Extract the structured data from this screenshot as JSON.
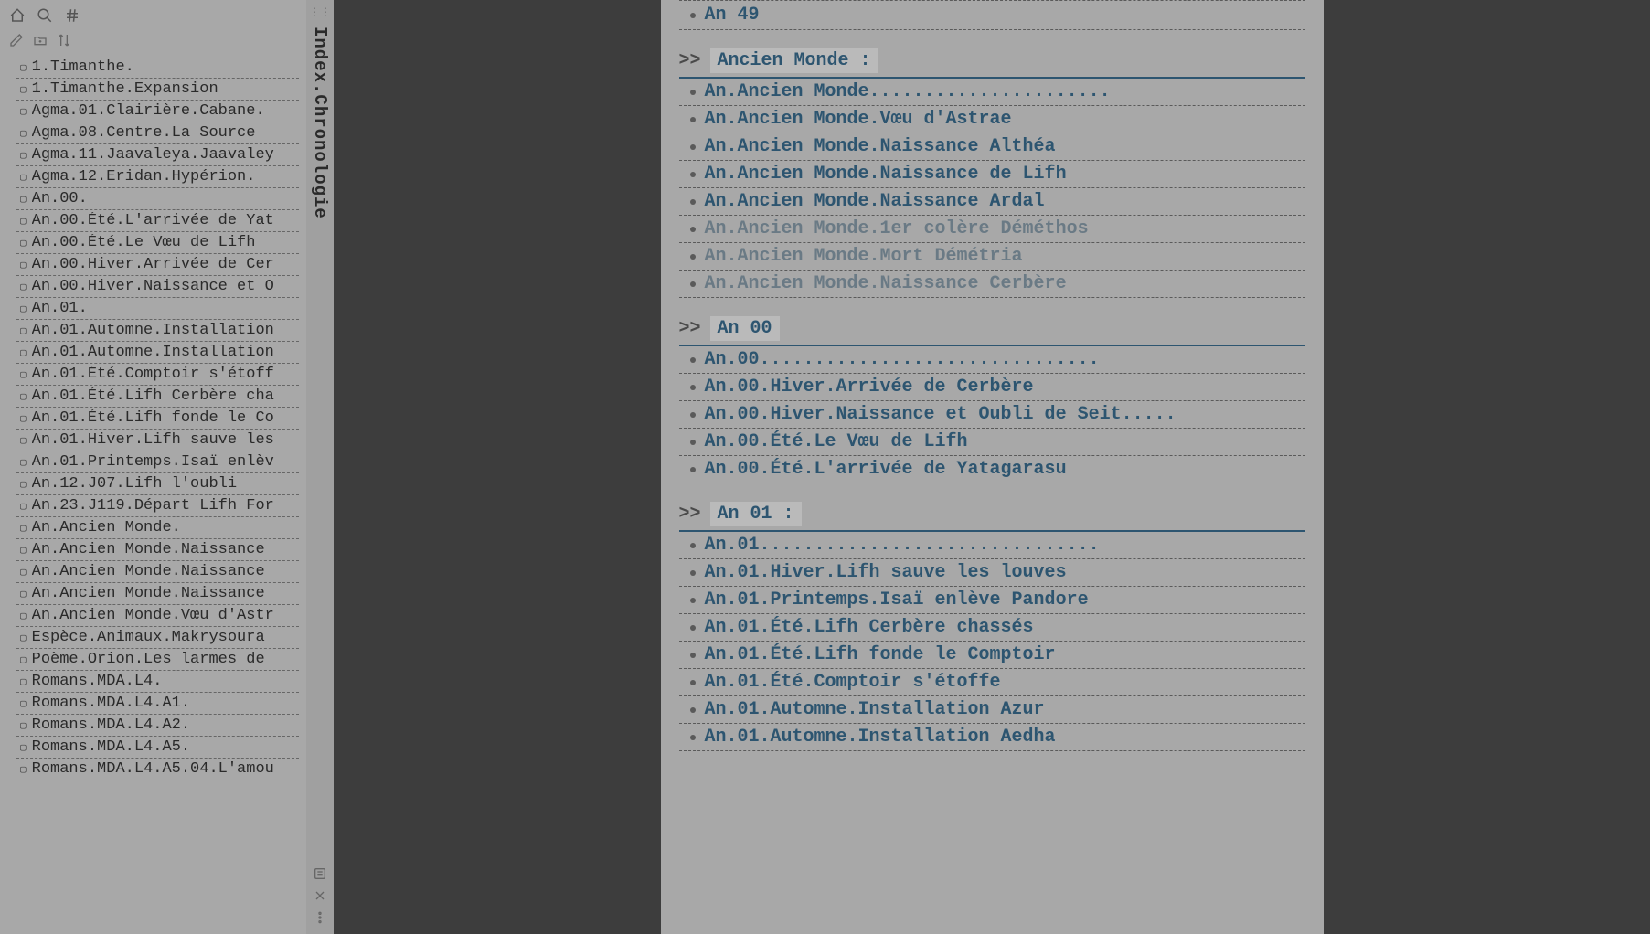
{
  "tab": {
    "title": "Index.Chronologie"
  },
  "sidebar_items": [
    "1.Timanthe.",
    "1.Timanthe.Expansion",
    "Agma.01.Clairière.Cabane.",
    "Agma.08.Centre.La Source",
    "Agma.11.Jaavaleya.Jaavaley",
    "Agma.12.Eridan.Hypérion.",
    "An.00.",
    "An.00.Été.L'arrivée de Yat",
    "An.00.Été.Le Vœu de Lifh",
    "An.00.Hiver.Arrivée de Cer",
    "An.00.Hiver.Naissance et O",
    "An.01.",
    "An.01.Automne.Installation",
    "An.01.Automne.Installation",
    "An.01.Été.Comptoir s'étoff",
    "An.01.Été.Lifh Cerbère cha",
    "An.01.Été.Lifh fonde le Co",
    "An.01.Hiver.Lifh sauve les",
    "An.01.Printemps.Isaï enlèv",
    "An.12.J07.Lifh l'oubli",
    "An.23.J119.Départ Lifh For",
    "An.Ancien Monde.",
    "An.Ancien Monde.Naissance",
    "An.Ancien Monde.Naissance",
    "An.Ancien Monde.Naissance",
    "An.Ancien Monde.Vœu d'Astr",
    "Espèce.Animaux.Makrysoura",
    "Poème.Orion.Les larmes de",
    "Romans.MDA.L4.",
    "Romans.MDA.L4.A1.",
    "Romans.MDA.L4.A2.",
    "Romans.MDA.L4.A5.",
    "Romans.MDA.L4.A5.04.L'amou"
  ],
  "content": {
    "top_item": "An 49",
    "sections": [
      {
        "title": "Ancien Monde :",
        "entries": [
          {
            "text": "An.Ancien Monde......................",
            "grey": false
          },
          {
            "text": "An.Ancien Monde.Vœu d'Astrae",
            "grey": false
          },
          {
            "text": "An.Ancien Monde.Naissance Althéa",
            "grey": false
          },
          {
            "text": "An.Ancien Monde.Naissance de Lifh",
            "grey": false
          },
          {
            "text": "An.Ancien Monde.Naissance Ardal",
            "grey": false
          },
          {
            "text": "An.Ancien Monde.1er colère Déméthos",
            "grey": true
          },
          {
            "text": "An.Ancien Monde.Mort Démétria",
            "grey": true
          },
          {
            "text": "An.Ancien Monde.Naissance Cerbère",
            "grey": true
          }
        ]
      },
      {
        "title": "An 00",
        "entries": [
          {
            "text": "An.00...............................",
            "grey": false
          },
          {
            "text": "An.00.Hiver.Arrivée de Cerbère",
            "grey": false
          },
          {
            "text": "An.00.Hiver.Naissance et Oubli de Seit.....",
            "grey": false
          },
          {
            "text": "An.00.Été.Le Vœu de Lifh",
            "grey": false
          },
          {
            "text": "An.00.Été.L'arrivée de Yatagarasu",
            "grey": false
          }
        ]
      },
      {
        "title": "An 01 :",
        "entries": [
          {
            "text": "An.01...............................",
            "grey": false
          },
          {
            "text": "An.01.Hiver.Lifh sauve les louves",
            "grey": false
          },
          {
            "text": "An.01.Printemps.Isaï enlève Pandore",
            "grey": false
          },
          {
            "text": "An.01.Été.Lifh Cerbère chassés",
            "grey": false
          },
          {
            "text": "An.01.Été.Lifh fonde le Comptoir",
            "grey": false
          },
          {
            "text": "An.01.Été.Comptoir s'étoffe",
            "grey": false
          },
          {
            "text": "An.01.Automne.Installation Azur",
            "grey": false
          },
          {
            "text": "An.01.Automne.Installation Aedha",
            "grey": false
          }
        ]
      }
    ]
  }
}
